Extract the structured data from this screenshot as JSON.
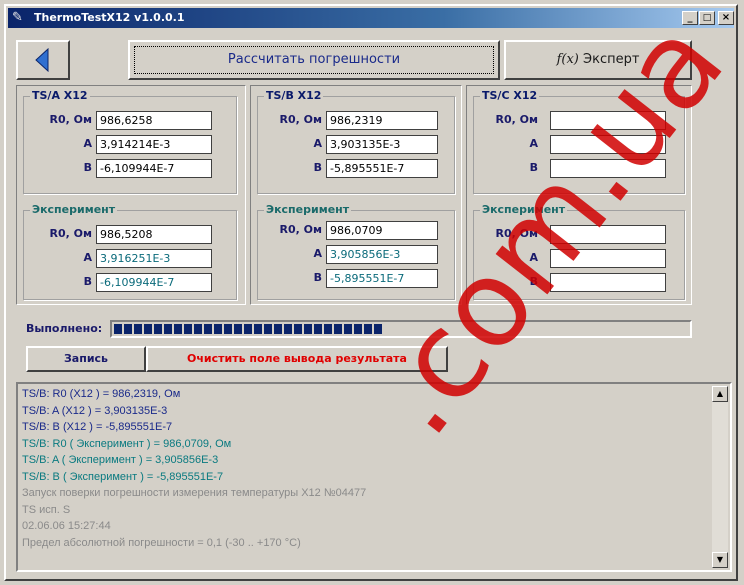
{
  "window": {
    "title": "ThermoTestX12 v1.0.0.1",
    "minimize": "_",
    "maximize": "□",
    "close": "×"
  },
  "toolbar": {
    "calc_label": "Рассчитать погрешности",
    "expert_fx": "f(x)",
    "expert_label": "Эксперт"
  },
  "labels": {
    "r0": "R0, Ом",
    "a": "A",
    "b": "B"
  },
  "panels": [
    {
      "title": "TS/A X12",
      "r0": "986,6258",
      "a": "3,914214E-3",
      "b": "-6,109944E-7",
      "exp_title": "Эксперимент",
      "exp_r0": "986,5208",
      "exp_a": "3,916251E-3",
      "exp_b": "-6,109944E-7"
    },
    {
      "title": "TS/B X12",
      "r0": "986,2319",
      "a": "3,903135E-3",
      "b": "-5,895551E-7",
      "exp_title": "Эксперимент",
      "exp_r0": "986,0709",
      "exp_a": "3,905856E-3",
      "exp_b": "-5,895551E-7"
    },
    {
      "title": "TS/C X12",
      "r0": "",
      "a": "",
      "b": "",
      "exp_title": "Эксперимент",
      "exp_r0": "",
      "exp_a": "",
      "exp_b": ""
    }
  ],
  "progress": {
    "label": "Выполнено:",
    "fraction": 0.47
  },
  "actions": {
    "save_label": "Запись",
    "clear_label": "Очистить поле вывода результата"
  },
  "log": [
    {
      "text": "TS/B: R0 (X12 ) = 986,2319, Ом",
      "color": "#1a2a8a"
    },
    {
      "text": "TS/B: A (X12 ) = 3,903135E-3",
      "color": "#1a2a8a"
    },
    {
      "text": "TS/B: B (X12 ) = -5,895551E-7",
      "color": "#1a2a8a"
    },
    {
      "text": "TS/B: R0 ( Эксперимент ) = 986,0709, Ом",
      "color": "#0a7a80"
    },
    {
      "text": "TS/B: A ( Эксперимент ) = 3,905856E-3",
      "color": "#0a7a80"
    },
    {
      "text": "TS/B: B ( Эксперимент ) = -5,895551E-7",
      "color": "#0a7a80"
    },
    {
      "text": "Запуск поверки погрешности измерения температуры X12 №04477",
      "color": "#8a8a8a"
    },
    {
      "text": "TS исп. S",
      "color": "#8a8a8a"
    },
    {
      "text": "02.06.06 15:27:44",
      "color": "#8a8a8a"
    },
    {
      "text": "Предел абсолютной погрешности = 0,1 (-30 .. +170 °C)",
      "color": "#8a8a8a"
    }
  ],
  "watermark": {
    "text": ".com.ua",
    "color": "#d00000"
  }
}
